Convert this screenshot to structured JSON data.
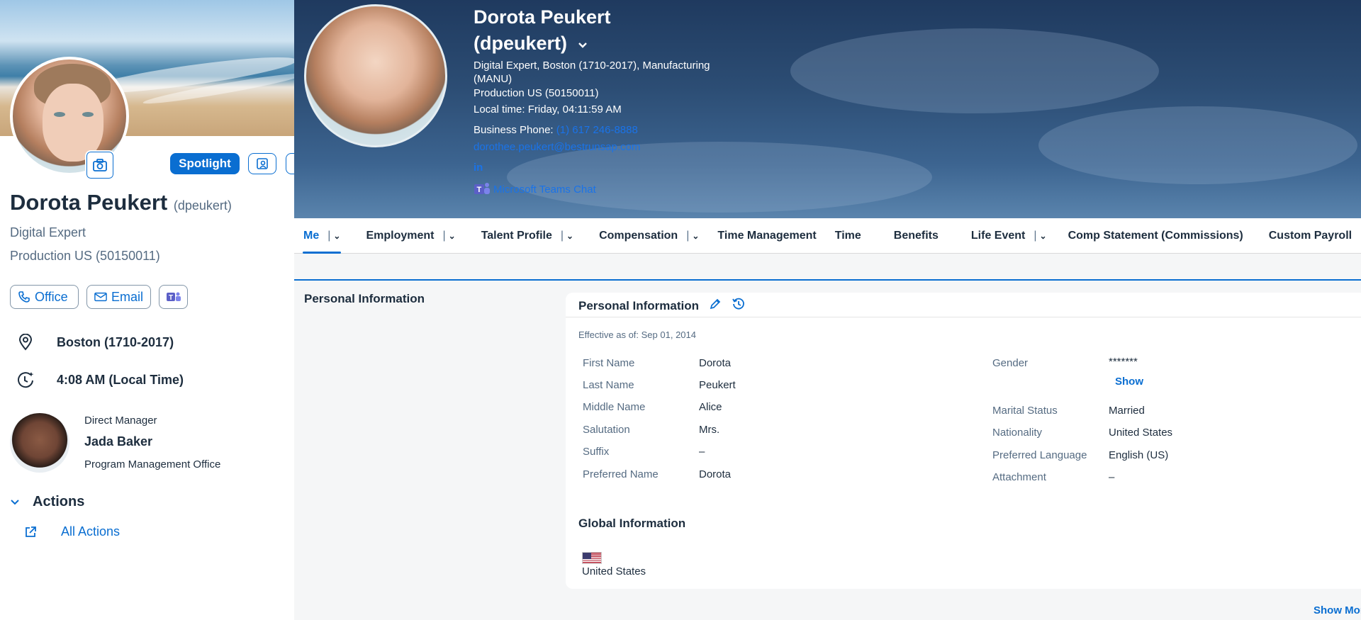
{
  "profile": {
    "name": "Dorota Peukert",
    "username": "(dpeukert)",
    "title": "Digital Expert",
    "department": "Production US (50150011)",
    "spotlight_label": "Spotlight",
    "office_label": "Office",
    "email_label": "Email",
    "location": "Boston (1710-2017)",
    "local_time": "4:08 AM (Local Time)"
  },
  "manager": {
    "label": "Direct Manager",
    "name": "Jada Baker",
    "department": "Program Management Office"
  },
  "actions": {
    "heading": "Actions",
    "all_actions": "All Actions"
  },
  "header": {
    "name_line1": "Dorota Peukert",
    "name_line2": "(dpeukert)",
    "subtitle_line1": "Digital Expert, Boston (1710-2017), Manufacturing",
    "subtitle_line2": "(MANU)",
    "department": "Production US (50150011)",
    "local_time": "Local time: Friday, 04:11:59 AM",
    "business_phone_label": "Business Phone:",
    "business_phone": "(1) 617 246-8888",
    "email": "dorothee.peukert@bestrunsap.com",
    "linkedin": "in",
    "teams_chat": "Microsoft Teams Chat"
  },
  "tabs": [
    {
      "label": "Me",
      "dropdown": true,
      "active": true
    },
    {
      "label": "Employment",
      "dropdown": true
    },
    {
      "label": "Talent Profile",
      "dropdown": true
    },
    {
      "label": "Compensation",
      "dropdown": true
    },
    {
      "label": "Time Management",
      "dropdown": false
    },
    {
      "label": "Time",
      "dropdown": false
    },
    {
      "label": "Benefits",
      "dropdown": false
    },
    {
      "label": "Life Event",
      "dropdown": true
    },
    {
      "label": "Comp Statement (Commissions)",
      "dropdown": false
    },
    {
      "label": "Custom Payroll",
      "dropdown": false
    }
  ],
  "section_nav": "Personal Information",
  "personal_info": {
    "title": "Personal Information",
    "effective": "Effective as of: Sep 01, 2014",
    "left_fields": [
      {
        "label": "First Name",
        "value": "Dorota"
      },
      {
        "label": "Last Name",
        "value": "Peukert"
      },
      {
        "label": "Middle Name",
        "value": "Alice"
      },
      {
        "label": "Salutation",
        "value": "Mrs."
      },
      {
        "label": "Suffix",
        "value": "–"
      },
      {
        "label": "Preferred Name",
        "value": "Dorota"
      }
    ],
    "gender_label": "Gender",
    "gender_value": "*******",
    "show_label": "Show",
    "right_fields": [
      {
        "label": "Marital Status",
        "value": "Married"
      },
      {
        "label": "Nationality",
        "value": "United States"
      },
      {
        "label": "Preferred Language",
        "value": "English (US)"
      },
      {
        "label": "Attachment",
        "value": "–"
      }
    ],
    "global_title": "Global Information",
    "country": "United States"
  },
  "show_more": "Show More"
}
